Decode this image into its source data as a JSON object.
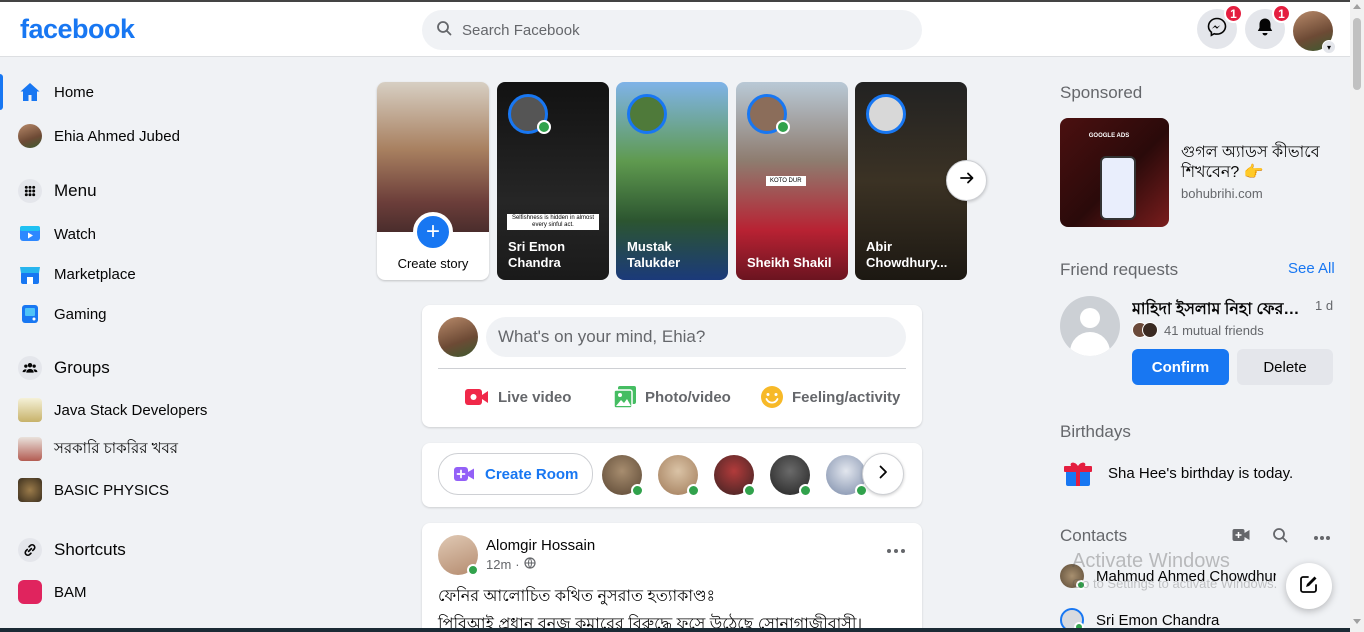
{
  "brand": {
    "logo_text": "facebook",
    "accent": "#1877f2"
  },
  "search": {
    "placeholder": "Search Facebook"
  },
  "header": {
    "messenger_badge": "1",
    "notifications_badge": "1",
    "icons": [
      "messenger-icon",
      "bell-icon",
      "profile-avatar",
      "chevron-down-icon"
    ]
  },
  "sidebar": {
    "items": [
      {
        "label": "Home",
        "icon": "home-icon",
        "active": true
      },
      {
        "label": "Ehia Ahmed Jubed",
        "icon": "avatar"
      },
      {
        "label": "Menu",
        "icon": "menu-grid-icon"
      },
      {
        "label": "Watch",
        "icon": "watch-icon"
      },
      {
        "label": "Marketplace",
        "icon": "marketplace-icon"
      },
      {
        "label": "Gaming",
        "icon": "gaming-icon"
      },
      {
        "label": "Groups",
        "icon": "groups-icon"
      },
      {
        "label": "Java Stack Developers",
        "icon": "group-avatar"
      },
      {
        "label": "সরকারি চাকরির খবর",
        "icon": "group-avatar"
      },
      {
        "label": "BASIC PHYSICS",
        "icon": "group-avatar"
      },
      {
        "label": "Shortcuts",
        "icon": "link-icon"
      },
      {
        "label": "BAM",
        "icon": "app-icon"
      }
    ]
  },
  "stories": {
    "create_label": "Create story",
    "items": [
      {
        "name": "Sri Emon Chandra",
        "caption": "Selfishness is hidden in almost every sinful act."
      },
      {
        "name": "Mustak Talukder"
      },
      {
        "name": "Sheikh Shakil",
        "caption": "KOTO DUR"
      },
      {
        "name": "Abir Chowdhury..."
      }
    ]
  },
  "composer": {
    "placeholder": "What's on your mind, Ehia?",
    "actions": [
      "Live video",
      "Photo/video",
      "Feeling/activity"
    ]
  },
  "rooms": {
    "create_label": "Create Room"
  },
  "post": {
    "author": "Alomgir Hossain",
    "time": "12m",
    "line1": "ফেনির আলোচিত কথিত নুসরাত হত্যাকাণ্ডঃ",
    "line2": "পিবিআই প্রধান বনজ কুমারের বিরুদ্ধে ফুসে উঠেছে সোনাগাজীবাসী।"
  },
  "right": {
    "sponsored_title": "Sponsored",
    "ad": {
      "title": "গুগল অ্যাডস কীভাবে শিখবেন? 👉",
      "url": "bohubrihi.com",
      "image_text": "GOOGLE ADS"
    },
    "friend_requests_title": "Friend requests",
    "see_all": "See All",
    "request": {
      "name": "মাহিদা ইসলাম নিহা ফেরদৌসী",
      "time": "1 d",
      "mutual": "41 mutual friends",
      "confirm": "Confirm",
      "delete": "Delete"
    },
    "birthdays_title": "Birthdays",
    "birthday_name": "Sha Hee",
    "birthday_rest": "'s birthday is today.",
    "contacts_title": "Contacts",
    "contacts": [
      "Mahmud Ahmed Chowdhury",
      "Sri Emon Chandra"
    ]
  },
  "watermark": {
    "title": "Activate Windows",
    "subtitle": "Go to Settings to activate Windows."
  }
}
